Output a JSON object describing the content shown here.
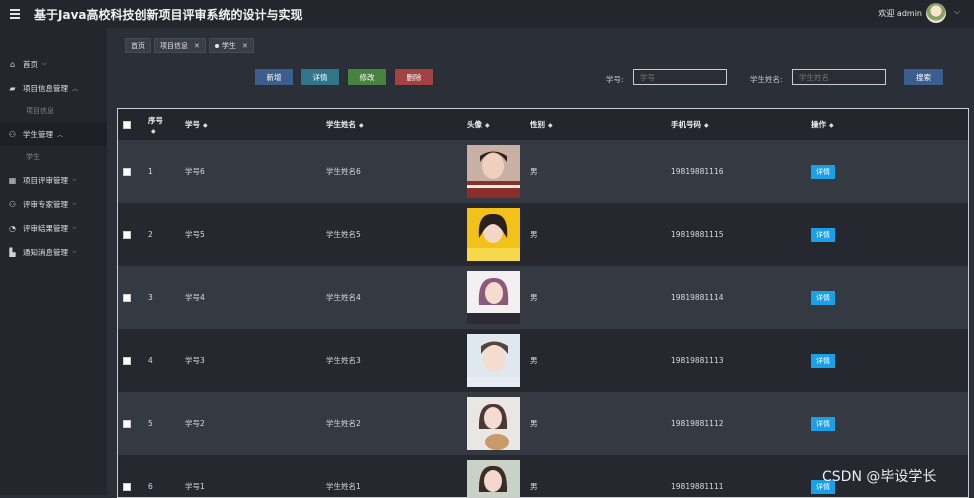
{
  "app": {
    "title": "基于Java高校科技创新项目评审系统的设计与实现",
    "welcome": "欢迎 admin"
  },
  "sidebar": {
    "items": [
      {
        "label": "首页",
        "icon": "home-icon"
      },
      {
        "label": "项目信息管理",
        "icon": "folder-icon",
        "sub": "项目信息"
      },
      {
        "label": "学生管理",
        "icon": "user-icon",
        "sub": "学生"
      },
      {
        "label": "项目评审管理",
        "icon": "grid-icon"
      },
      {
        "label": "评审专家管理",
        "icon": "user-icon"
      },
      {
        "label": "评审结果管理",
        "icon": "pie-icon"
      },
      {
        "label": "通知消息管理",
        "icon": "chart-icon"
      }
    ]
  },
  "tabs": [
    {
      "label": "首页",
      "closable": false
    },
    {
      "label": "项目信息",
      "closable": true
    },
    {
      "label": "学生",
      "closable": true,
      "active": true
    }
  ],
  "toolbar": {
    "add": "新增",
    "detail": "详情",
    "edit": "修改",
    "delete": "删除",
    "search": "搜索"
  },
  "filters": {
    "student_no_label": "学号:",
    "student_no_placeholder": "学号",
    "student_name_label": "学生姓名:",
    "student_name_placeholder": "学生姓名"
  },
  "table": {
    "headers": [
      "序号",
      "学号",
      "学生姓名",
      "头像",
      "性别",
      "手机号码",
      "操作"
    ],
    "rows": [
      {
        "index": "1",
        "no": "学号6",
        "name": "学生姓名6",
        "gender": "男",
        "phone": "19819881116",
        "action": "详情"
      },
      {
        "index": "2",
        "no": "学号5",
        "name": "学生姓名5",
        "gender": "男",
        "phone": "19819881115",
        "action": "详情"
      },
      {
        "index": "3",
        "no": "学号4",
        "name": "学生姓名4",
        "gender": "男",
        "phone": "19819881114",
        "action": "详情"
      },
      {
        "index": "4",
        "no": "学号3",
        "name": "学生姓名3",
        "gender": "男",
        "phone": "19819881113",
        "action": "详情"
      },
      {
        "index": "5",
        "no": "学号2",
        "name": "学生姓名2",
        "gender": "男",
        "phone": "19819881112",
        "action": "详情"
      },
      {
        "index": "6",
        "no": "学号1",
        "name": "学生姓名1",
        "gender": "男",
        "phone": "19819881111",
        "action": "详情"
      }
    ]
  },
  "watermark": "CSDN @毕设学长"
}
